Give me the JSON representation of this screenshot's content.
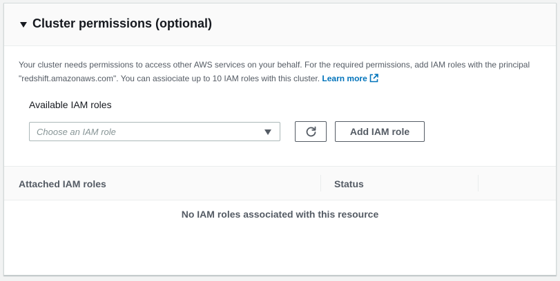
{
  "section": {
    "title": "Cluster permissions (optional)",
    "description": "Your cluster needs permissions to access other AWS services on your behalf. For the required permissions, add IAM roles with the principal \"redshift.amazonaws.com\". You can assiociate up to 10 IAM roles with this cluster.",
    "learn_more": "Learn more"
  },
  "iam_roles": {
    "label": "Available IAM roles",
    "placeholder": "Choose an IAM role",
    "add_button": "Add IAM role"
  },
  "table": {
    "columns": [
      "Attached IAM roles",
      "Status"
    ],
    "empty_message": "No IAM roles associated with this resource"
  },
  "colors": {
    "link": "#0073bb",
    "header_background": "#fafafa",
    "border": "#eaeded"
  },
  "icons": {
    "collapse": "caret-down-icon",
    "external_link": "external-link-icon",
    "refresh": "refresh-icon",
    "dropdown": "chevron-down-icon"
  }
}
